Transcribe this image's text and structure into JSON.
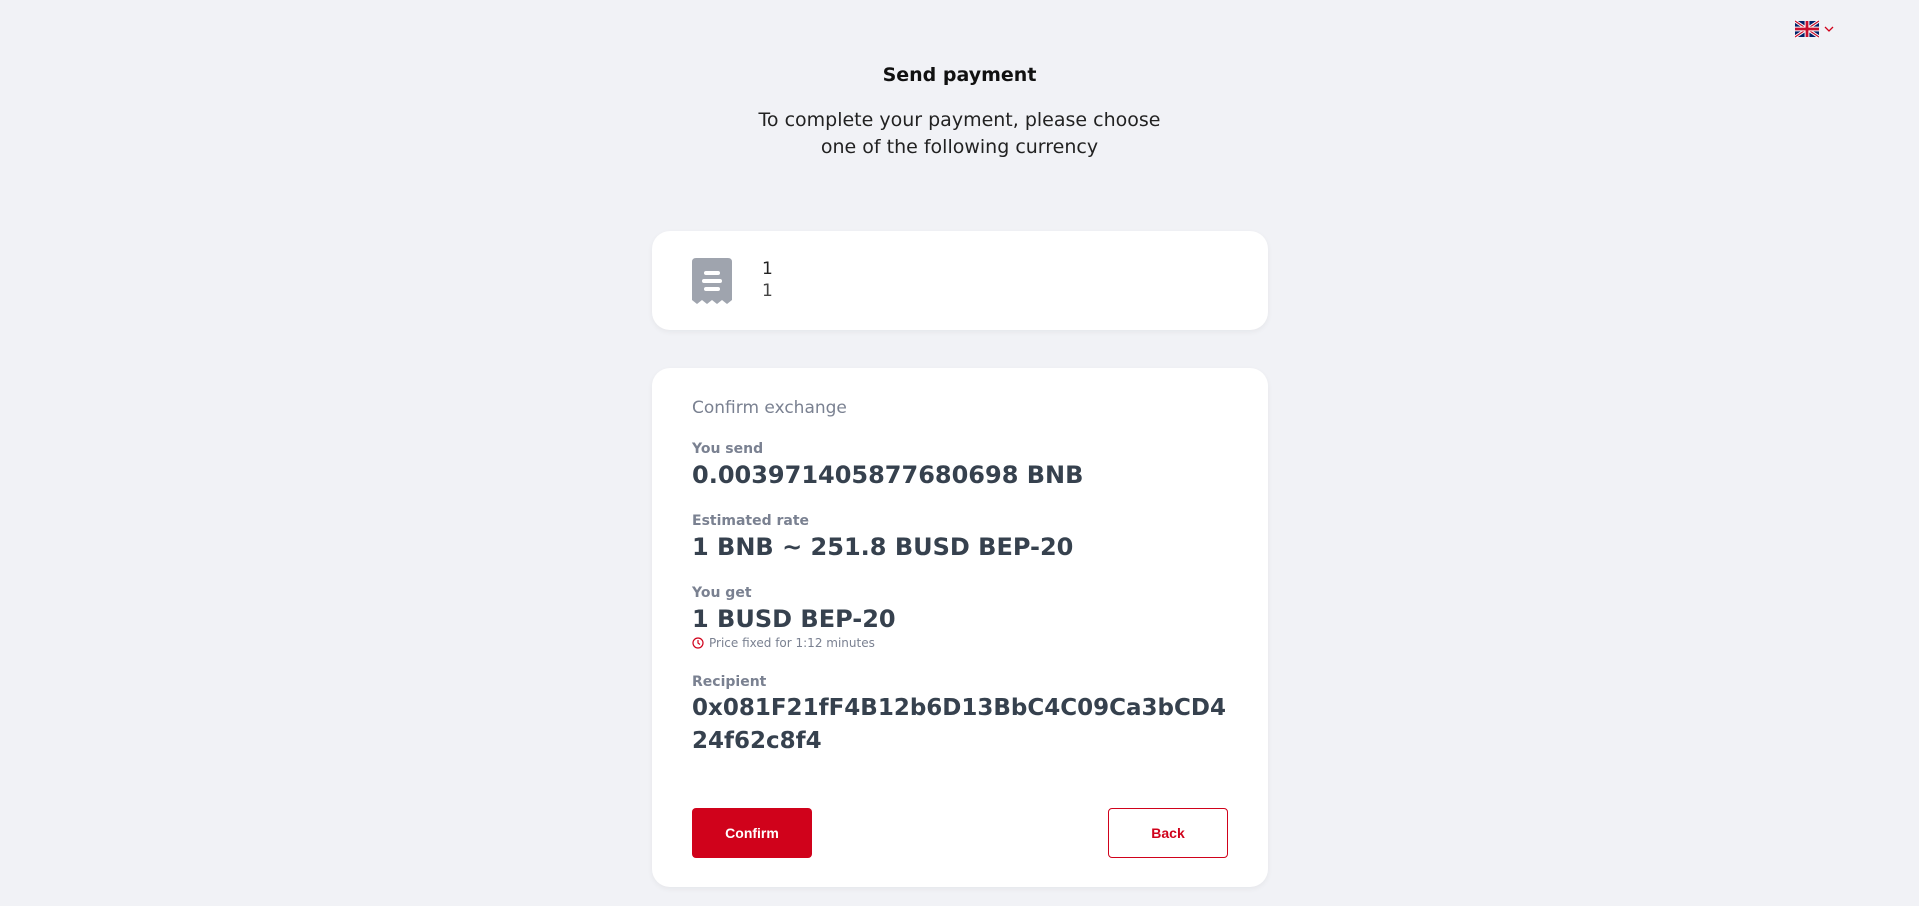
{
  "language": {
    "current": "English (UK)",
    "flag_icon": "uk-flag-icon",
    "dropdown_icon": "chevron-down-icon"
  },
  "header": {
    "title": "Send payment",
    "subtitle": "To complete your payment, please choose one of the following currency"
  },
  "order": {
    "icon": "receipt-icon",
    "line1": "1",
    "line2": "1"
  },
  "exchange": {
    "section_title": "Confirm exchange",
    "send_label": "You send",
    "send_value": "0.003971405877680698 BNB",
    "rate_label": "Estimated rate",
    "rate_value": "1 BNB ~ 251.8 BUSD BEP-20",
    "get_label": "You get",
    "get_value": "1 BUSD BEP-20",
    "price_fixed": "Price fixed for 1:12 minutes",
    "recipient_label": "Recipient",
    "recipient_value": "0x081F21fF4B12b6D13BbC4C09Ca3bCD424f62c8f4"
  },
  "actions": {
    "confirm_label": "Confirm",
    "back_label": "Back"
  },
  "colors": {
    "accent": "#d0021b",
    "background": "#f1f2f6",
    "card": "#ffffff",
    "muted_text": "#7a8191",
    "value_text": "#36414e"
  }
}
